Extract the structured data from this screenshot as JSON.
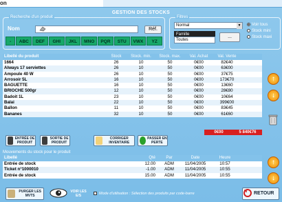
{
  "top": {
    "label": "on"
  },
  "title": "GESTION DES STOCKS",
  "search": {
    "panel_title": "Recherche d'un produit",
    "name_label": "Nom",
    "name_value": "",
    "ref_button": "Réf.",
    "letters": [
      "ABC",
      "DEF",
      "GHI",
      "JKL",
      "MNO",
      "PQR",
      "STU",
      "VWX",
      "YZ"
    ]
  },
  "filters": {
    "panel_title": "Filtres",
    "mode_value": "Normal",
    "family_label": "Famille",
    "family_value": "Toutes",
    "family_button": "...",
    "radio_all": "Voir tous",
    "radio_min": "Stock mini",
    "radio_max": "Stock maxi"
  },
  "table": {
    "headers": [
      "Libellé du produit",
      "Stock",
      "Stock. min.",
      "Stock. max.",
      "Val. Achat",
      "Val. Vente"
    ],
    "rows": [
      [
        "1664",
        "26",
        "10",
        "50",
        "0€00",
        "82€40"
      ],
      [
        "Always 17 serviettes",
        "26",
        "10",
        "50",
        "0€00",
        "63€00"
      ],
      [
        "Ampoule 40 W",
        "26",
        "10",
        "50",
        "0€00",
        "37€75"
      ],
      [
        "Arrosoir 5L",
        "16",
        "10",
        "50",
        "0€00",
        "173€70"
      ],
      [
        "BAGUETTE",
        "16",
        "10",
        "50",
        "0€00",
        "13€60"
      ],
      [
        "BRIOCHE 500gr",
        "12",
        "10",
        "50",
        "0€00",
        "28€80"
      ],
      [
        "Badoit 1L",
        "23",
        "10",
        "50",
        "0€00",
        "10€64"
      ],
      [
        "Balai",
        "22",
        "10",
        "50",
        "0€00",
        "399€00"
      ],
      [
        "Ballon",
        "11",
        "10",
        "50",
        "0€00",
        "83€45"
      ],
      [
        "Bananes",
        "32",
        "10",
        "50",
        "0€00",
        "61€60"
      ]
    ],
    "total_purchase": "0€00",
    "total_sale": "5 840€76"
  },
  "actions": {
    "entry": "ENTRÉE DE PRODUIT",
    "exit": "SORTIE DE PRODUIT",
    "inventory": "CORRIGER INVENTAIRE",
    "loss": "PASSER EN PERTE"
  },
  "movements": {
    "title": "Mouvements du stock pour le produit",
    "headers": [
      "Libellé",
      "Qté",
      "Par",
      "Date",
      "Heure"
    ],
    "rows": [
      [
        "Entrée de stock",
        "12.00",
        "ADM",
        "11/04/2005",
        "10:57"
      ],
      [
        "Ticket n°1000010",
        "-1.00",
        "ADM",
        "11/04/2005",
        "10:55"
      ],
      [
        "Entrée de stock",
        "15.00",
        "ADM",
        "11/04/2005",
        "10:55"
      ]
    ]
  },
  "footer": {
    "purge": "PURGER LES MVTS",
    "view": "VOIR LES E/S",
    "note": "Mode d'utilisation : Sélection des produits par code-barre",
    "back": "RETOUR"
  },
  "colors": {
    "background": "#83c2ea",
    "letters": "#18a86a",
    "totals": "#d82020",
    "arrows": "#f08a00"
  }
}
